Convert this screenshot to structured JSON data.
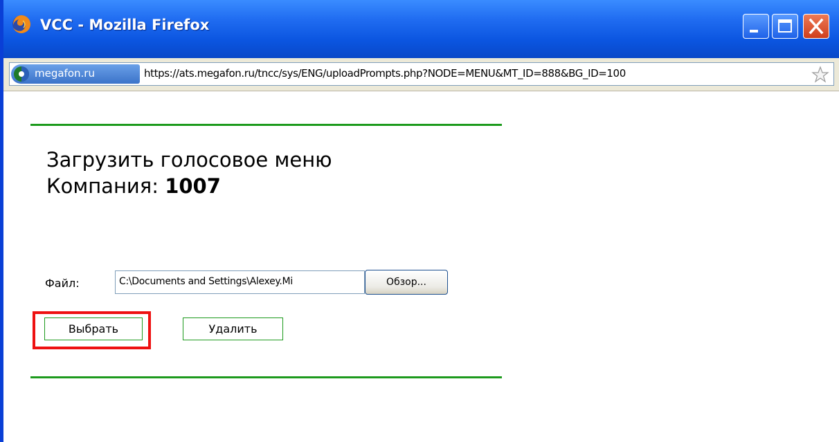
{
  "window": {
    "title": "VCC - Mozilla Firefox",
    "controls": [
      "minimize",
      "maximize",
      "close"
    ]
  },
  "urlbar": {
    "site_domain": "megafon.ru",
    "url": "https://ats.megafon.ru/tncc/sys/ENG/uploadPrompts.php?NODE=MENU&MT_ID=888&BG_ID=100",
    "icons": [
      "site-globe-icon",
      "bookmark-star-icon"
    ]
  },
  "page": {
    "heading_line1": "Загрузить голосовое меню",
    "company_label": "Компания: ",
    "company_id": "1007",
    "file_label": "Файл:",
    "file_value": "C:\\Documents and Settings\\Alexey.Mi",
    "browse_label": "Обзор...",
    "select_label": "Выбрать",
    "delete_label": "Удалить",
    "colors": {
      "divider": "#1c9a1c",
      "highlight": "#ee1111",
      "titlebar": "#0b55e0"
    }
  }
}
